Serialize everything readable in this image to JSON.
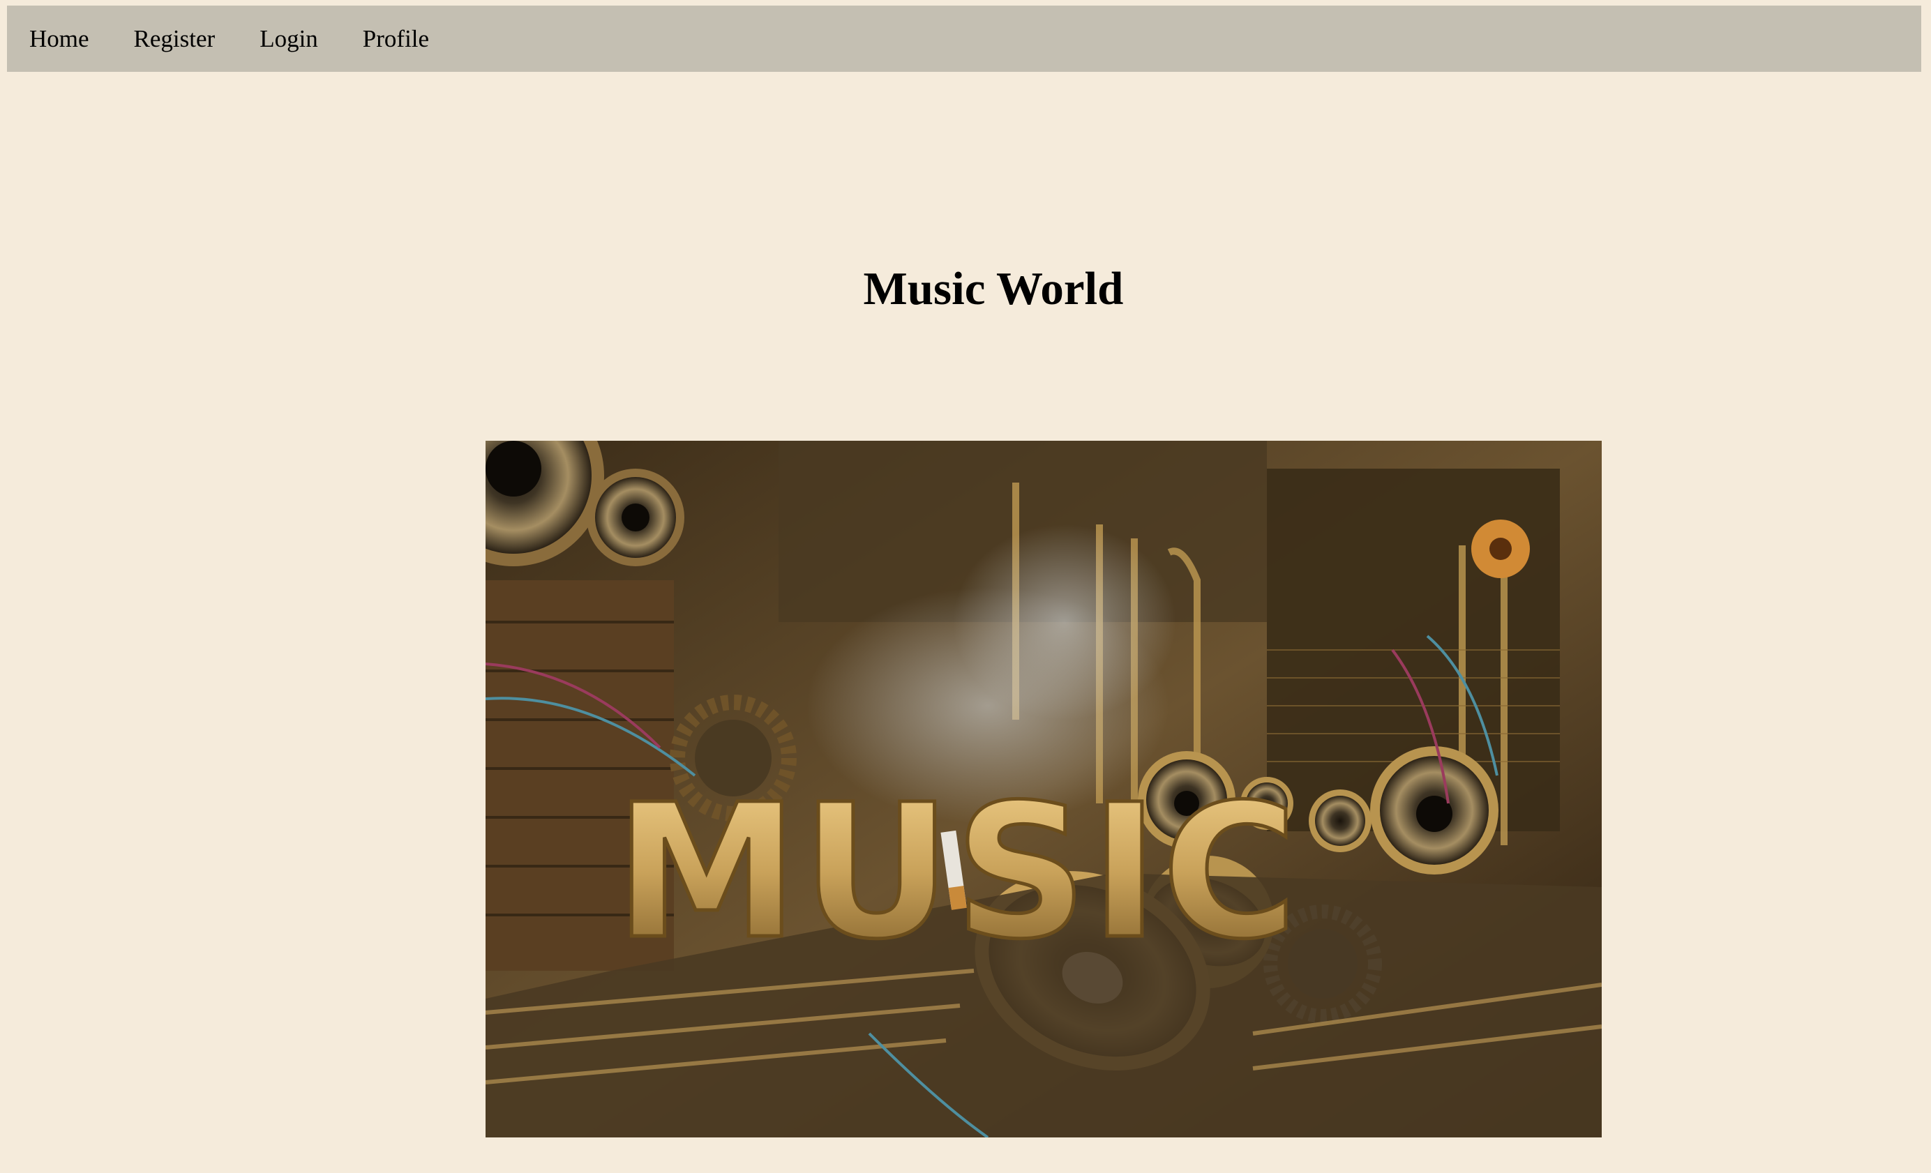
{
  "nav": {
    "items": [
      {
        "label": "Home"
      },
      {
        "label": "Register"
      },
      {
        "label": "Login"
      },
      {
        "label": "Profile"
      }
    ]
  },
  "header": {
    "title": "Music World"
  },
  "hero": {
    "image_word": "MUSIC",
    "colors": {
      "background": "#f5ebdb",
      "navbar": "#c4bfb2",
      "brass": "#c9a25a",
      "dark": "#2a1f12"
    }
  }
}
